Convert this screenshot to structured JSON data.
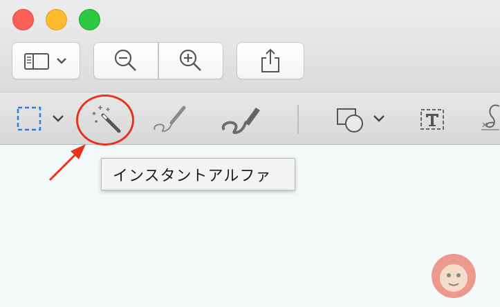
{
  "window": {
    "traffic_lights": [
      "close",
      "minimize",
      "zoom"
    ],
    "colors": {
      "close": "#fc5f57",
      "minimize": "#fdbb2e",
      "zoom": "#2cc840"
    }
  },
  "toolbar": {
    "buttons": [
      {
        "name": "sidebar-toggle",
        "icon": "sidebar-icon",
        "has_menu": true
      },
      {
        "name": "zoom-out",
        "icon": "zoom-out-icon"
      },
      {
        "name": "zoom-in",
        "icon": "zoom-in-icon"
      },
      {
        "name": "share",
        "icon": "share-icon"
      }
    ]
  },
  "markup_toolbar": {
    "tools": [
      {
        "name": "rectangular-selection",
        "icon": "dashed-rectangle-icon",
        "has_menu": true,
        "color": "#2a7de1"
      },
      {
        "name": "instant-alpha",
        "icon": "magic-wand-icon"
      },
      {
        "name": "sketch",
        "icon": "sketch-pen-icon"
      },
      {
        "name": "draw",
        "icon": "draw-pen-icon"
      },
      {
        "name": "shapes",
        "icon": "shapes-icon",
        "has_menu": true
      },
      {
        "name": "text",
        "icon": "text-box-icon"
      },
      {
        "name": "sign",
        "icon": "signature-icon"
      }
    ]
  },
  "tooltip": {
    "text": "インスタントアルファ"
  },
  "annotation": {
    "highlight_color": "#e8331c",
    "watermark_icon": "monkey-face-icon"
  }
}
